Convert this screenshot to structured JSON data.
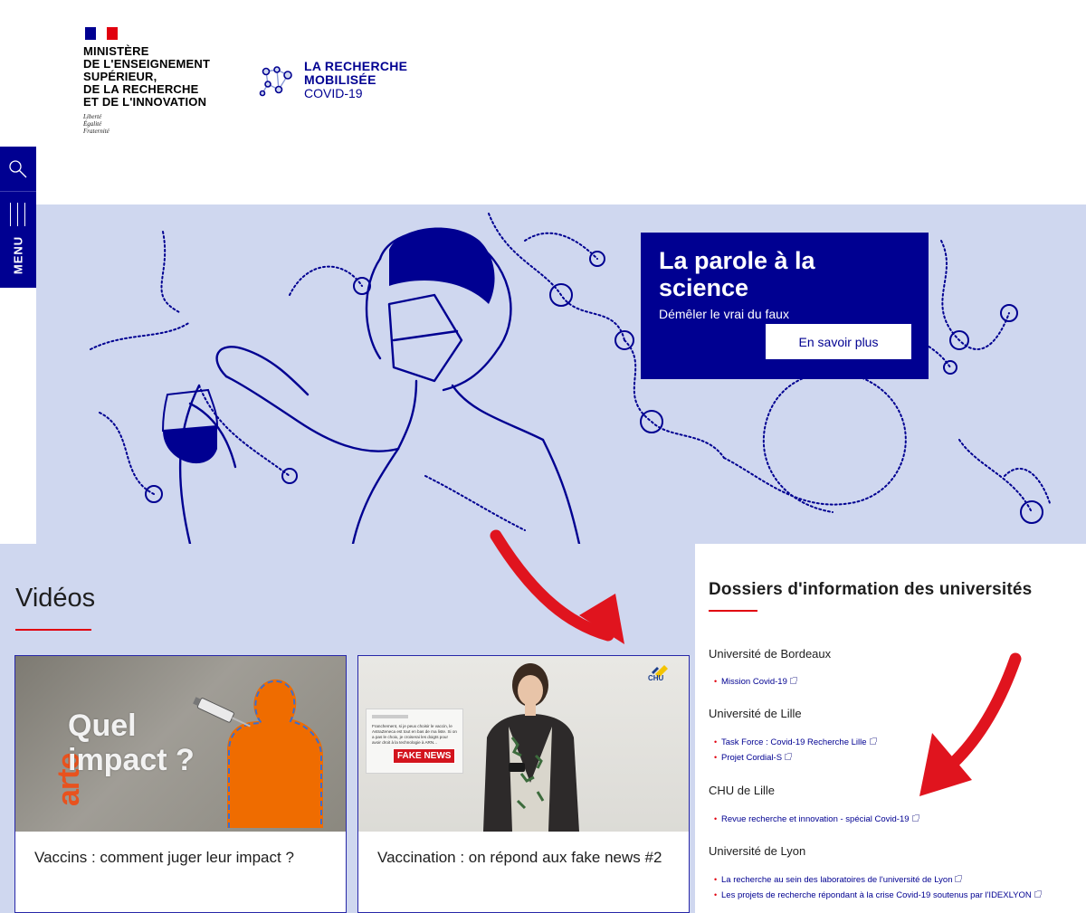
{
  "header": {
    "ministry_lines": [
      "MINISTÈRE",
      "DE L'ENSEIGNEMENT",
      "SUPÉRIEUR,",
      "DE LA RECHERCHE",
      "ET DE L'INNOVATION"
    ],
    "motto_lines": [
      "Liberté",
      "Égalité",
      "Fraternité"
    ],
    "site_logo_lines": [
      "LA RECHERCHE",
      "MOBILISÉE",
      "COVID-19"
    ]
  },
  "side_nav": {
    "menu_label": "MENU"
  },
  "promo": {
    "title": "La parole à la science",
    "subtitle": "Démêler le vrai du faux",
    "button": "En savoir plus"
  },
  "videos": {
    "heading": "Vidéos",
    "items": [
      {
        "caption": "Vaccins : comment juger leur impact ?",
        "brand": "arte",
        "overlay_lines": [
          "Quel",
          "impact ?"
        ]
      },
      {
        "caption": "Vaccination : on répond aux fake news #2",
        "badge": "FAKE NEWS",
        "logo_text": "CHU",
        "tweet_text": "Franchement, si je peux choisir le vaccin, le AstraZeneca est tout en bas de ma liste. Si on a pas le choix, je croiserai les doigts pour avoir droit à la technologie à ARN..."
      }
    ]
  },
  "universities": {
    "heading": "Dossiers d'information des universités",
    "groups": [
      {
        "name": "Université de Bordeaux",
        "links": [
          "Mission Covid-19"
        ]
      },
      {
        "name": "Université de Lille",
        "links": [
          "Task Force : Covid-19 Recherche Lille",
          "Projet Cordial-S"
        ]
      },
      {
        "name": "CHU de Lille",
        "links": [
          "Revue recherche et innovation - spécial Covid-19"
        ]
      },
      {
        "name": "Université de Lyon",
        "links": [
          "La recherche au sein des laboratoires de l'université de Lyon",
          "Les projets de recherche répondant à la crise Covid-19 soutenus par l'IDEXLYON"
        ]
      }
    ]
  },
  "colors": {
    "brand_blue": "#000091",
    "accent_red": "#e1000f",
    "hero_bg": "#cfd7ef",
    "annotation_arrow": "#e0141e"
  }
}
